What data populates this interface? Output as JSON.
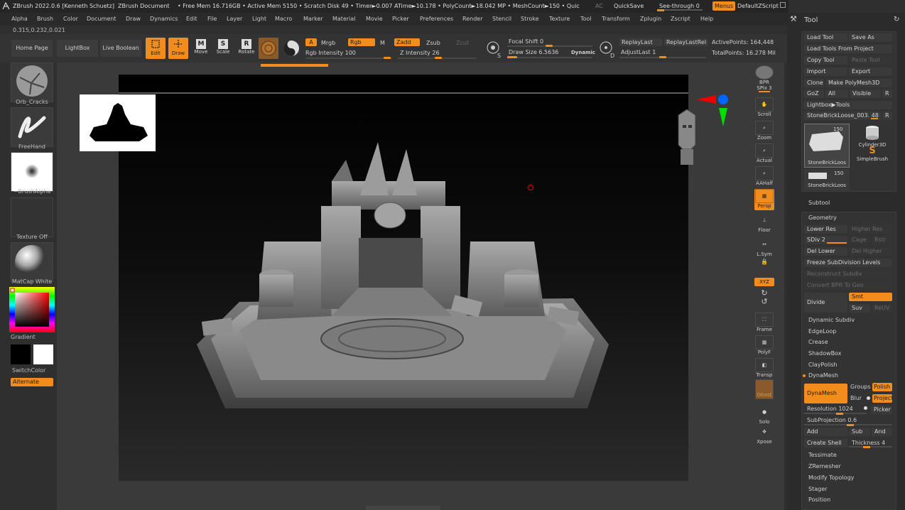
{
  "titlebar": {
    "app": "ZBrush 2022.0.6 [Kenneth Schuetz]",
    "doc": "ZBrush Document",
    "stats": "• Free Mem 16.716GB • Active Mem 5150 • Scratch Disk 49 • Timer►0.007 ATime►10.178 • PolyCount►18.042 MP • MeshCount►150 • Quic",
    "ac": "AC",
    "quicksave": "QuickSave",
    "seethrough": "See-through  0",
    "menus": "Menus",
    "defaultzscript": "DefaultZScript"
  },
  "menu": [
    "Alpha",
    "Brush",
    "Color",
    "Document",
    "Draw",
    "Dynamics",
    "Edit",
    "File",
    "Layer",
    "Light",
    "Macro",
    "Marker",
    "Material",
    "Movie",
    "Picker",
    "Preferences",
    "Render",
    "Stencil",
    "Stroke",
    "Texture",
    "Tool",
    "Transform",
    "Zplugin",
    "Zscript",
    "Help"
  ],
  "coords": "0.315,0.232,0.021",
  "toolbar": {
    "home": "Home Page",
    "lightbox": "LightBox",
    "liveboolean": "Live Boolean",
    "edit": "Edit",
    "draw": "Draw",
    "move": "Move",
    "scale": "Scale",
    "rotate": "Rotate",
    "a": "A",
    "mrgb": "Mrgb",
    "rgb": "Rgb",
    "m": "M",
    "zadd": "Zadd",
    "zsub": "Zsub",
    "zcut": "Zcut",
    "rgb_intensity": "Rgb Intensity 100",
    "z_intensity": "Z Intensity 26",
    "focal_shift": "Focal Shift 0",
    "draw_size": "Draw Size 6.5636",
    "dynamic": "Dynamic",
    "replaylast": "ReplayLast",
    "replaylastrel": "ReplayLastRel",
    "adjustlast": "AdjustLast  1",
    "activepoints": "ActivePoints: 164,448",
    "totalpoints": "TotalPoints: 16.278 Mil"
  },
  "left": {
    "brush": "Orb_Cracks",
    "stroke": "FreeHand",
    "alpha": "~BrushAlpha",
    "texture": "Texture Off",
    "material": "MatCap White",
    "gradient": "Gradient",
    "switchcolor": "SwitchColor",
    "alternate": "Alternate"
  },
  "shelf": [
    "BPR",
    "SPix 3",
    "Scroll",
    "Zoom",
    "Actual",
    "AAHalf",
    "Persp",
    "Floor",
    "L.Sym",
    "XYZ",
    "Frame",
    "PolyF",
    "Transp",
    "Ghost",
    "Solo",
    "Xpose"
  ],
  "tray": {
    "title": "Tool",
    "load_tool": "Load Tool",
    "save_as": "Save As",
    "load_from_project": "Load Tools From Project",
    "copy_tool": "Copy Tool",
    "paste_tool": "Paste Tool",
    "import": "Import",
    "export": "Export",
    "clone": "Clone",
    "make_polymesh": "Make PolyMesh3D",
    "goz": "GoZ",
    "all": "All",
    "visible": "Visible",
    "r": "R",
    "lightbox_tools": "Lightbox▶Tools",
    "tool_name": "StoneBrickLoose_003. 48",
    "r2": "R",
    "thumb1_label": "StoneBrickLoos",
    "thumb1_count": "150",
    "cyl_label": "Cylinder3D",
    "simple_label": "SimpleBrush",
    "thumb2_label": "StoneBrickLoos",
    "thumb2_count": "150",
    "subtool": "Subtool",
    "geometry": "Geometry",
    "lower_res": "Lower Res",
    "higher_res": "Higher Res",
    "sdiv": "SDiv 2",
    "cage": "Cage",
    "rstr": "Rstr",
    "del_lower": "Del Lower",
    "del_higher": "Del Higher",
    "freeze": "Freeze SubDivision Levels",
    "reconstruct": "Reconstruct Subdiv",
    "convert_bpr": "Convert BPR To Geo",
    "divide": "Divide",
    "smt": "Smt",
    "suv": "Suv",
    "reuv": "ReUV",
    "dynamic_subdiv": "Dynamic Subdiv",
    "edgeloop": "EdgeLoop",
    "crease": "Crease",
    "shadowbox": "ShadowBox",
    "claypolish": "ClayPolish",
    "dynamesh_header": "DynaMesh",
    "dynamesh_btn": "DynaMesh",
    "groups": "Groups",
    "polish": "Polish",
    "blur": "Blur",
    "project": "Project",
    "resolution": "Resolution 1024",
    "picker": "Picker",
    "subprojection": "SubProjection 0.6",
    "add": "Add",
    "sub": "Sub",
    "and": "And",
    "create_shell": "Create Shell",
    "thickness": "Thickness  4",
    "tessimate": "Tessimate",
    "zremesher": "ZRemesher",
    "modify_topology": "Modify Topology",
    "stager": "Stager",
    "position": "Position"
  },
  "colors": {
    "accent": "#f28c1c",
    "bg": "#2f2f2f"
  }
}
